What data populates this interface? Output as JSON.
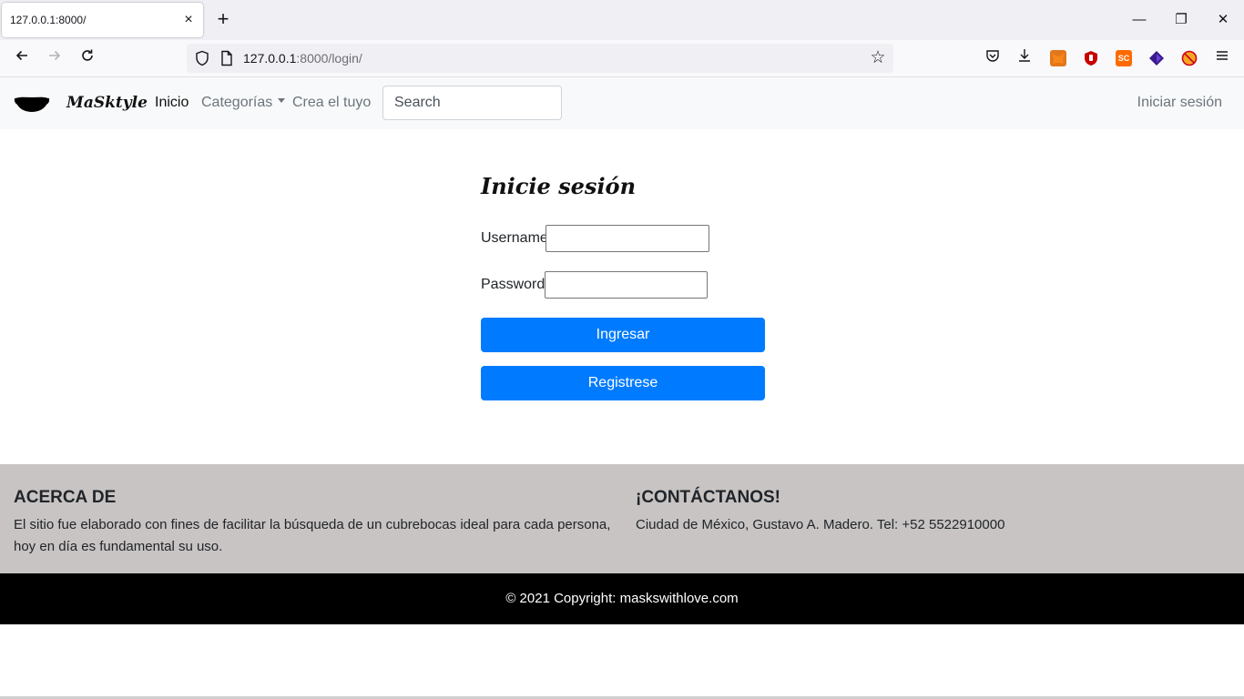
{
  "browser": {
    "tab_title": "127.0.0.1:8000/",
    "tab_close": "×",
    "new_tab": "+",
    "url_host": "127.0.0.1",
    "url_path": ":8000/login/",
    "icons": {
      "back": "back-arrow-icon",
      "forward": "forward-arrow-icon",
      "reload": "reload-icon",
      "bookmark": "star-icon",
      "pocket": "pocket-icon",
      "downloads": "download-icon",
      "menu": "hamburger-menu-icon"
    },
    "extensions": [
      {
        "name": "metamask-extension-icon",
        "color": "#e2761b"
      },
      {
        "name": "ublock-extension-icon",
        "color": "#e00000"
      },
      {
        "name": "sc-extension-icon",
        "label": "SC",
        "color": "#ff6a00"
      },
      {
        "name": "diamond-extension-icon",
        "color": "#3a1a8c"
      },
      {
        "name": "blocker-extension-icon",
        "color": "#e84a1a"
      }
    ],
    "window_controls": {
      "minimize": "—",
      "restore": "❐",
      "close": "✕"
    }
  },
  "navbar": {
    "brand": "MaSktyle",
    "links": {
      "inicio": "Inicio",
      "categorias": "Categorías",
      "crea": "Crea el tuyo"
    },
    "search_placeholder": "Search",
    "login": "Iniciar sesión"
  },
  "login_form": {
    "title": "Inicie sesión",
    "username_label": "Username:",
    "password_label": "Password:",
    "username_value": "",
    "password_value": "",
    "submit_label": "Ingresar",
    "register_label": "Registrese",
    "button_color": "#007bff"
  },
  "footer": {
    "about_heading": "ACERCA DE",
    "about_text": "El sitio fue elaborado con fines de facilitar la búsqueda de un cubrebocas ideal para cada persona, hoy en día es fundamental su uso.",
    "contact_heading": "¡CONTÁCTANOS!",
    "contact_text": "Ciudad de México, Gustavo A. Madero. Tel: +52 5522910000",
    "copyright": "© 2021 Copyright: maskswithlove.com",
    "background": "#c8c4c4"
  }
}
